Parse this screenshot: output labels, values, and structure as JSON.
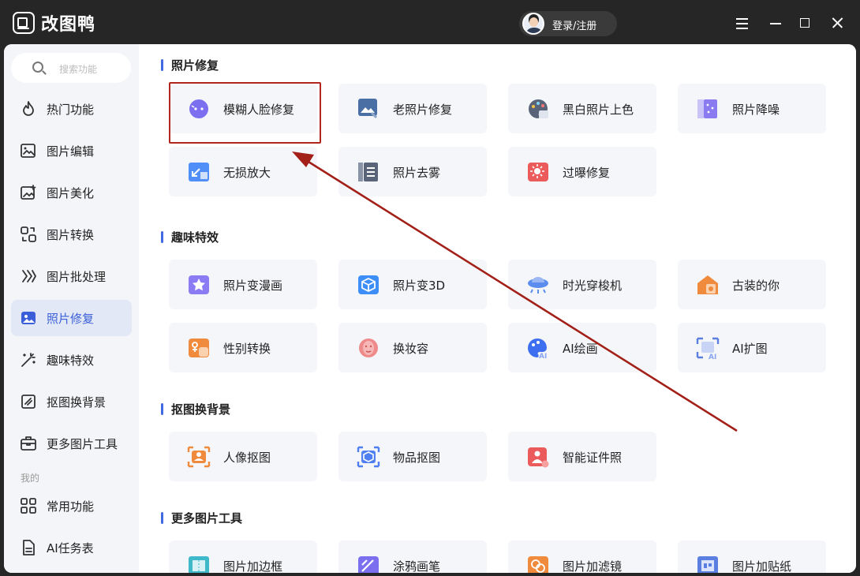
{
  "app": {
    "title": "改图鸭",
    "login_label": "登录/注册"
  },
  "sidebar": {
    "search_placeholder": "搜索功能",
    "items": [
      {
        "label": "热门功能",
        "icon": "fire-icon"
      },
      {
        "label": "图片编辑",
        "icon": "image-edit-icon"
      },
      {
        "label": "图片美化",
        "icon": "image-beautify-icon"
      },
      {
        "label": "图片转换",
        "icon": "convert-icon"
      },
      {
        "label": "图片批处理",
        "icon": "batch-icon"
      },
      {
        "label": "照片修复",
        "icon": "photo-repair-icon",
        "active": true
      },
      {
        "label": "趣味特效",
        "icon": "magic-wand-icon"
      },
      {
        "label": "抠图换背景",
        "icon": "cutout-icon"
      },
      {
        "label": "更多图片工具",
        "icon": "toolbox-icon"
      }
    ],
    "mine_label": "我的",
    "mine_items": [
      {
        "label": "常用功能",
        "icon": "grid-icon"
      },
      {
        "label": "AI任务表",
        "icon": "document-icon"
      }
    ]
  },
  "sections": [
    {
      "title": "照片修复",
      "cards": [
        {
          "label": "模糊人脸修复",
          "icon": "face-repair-icon",
          "color": "#7b6ff0"
        },
        {
          "label": "老照片修复",
          "icon": "old-photo-icon",
          "color": "#4a6fa5"
        },
        {
          "label": "黑白照片上色",
          "icon": "palette-icon",
          "color": "#5a6478"
        },
        {
          "label": "照片降噪",
          "icon": "denoise-icon",
          "color": "#8a7cf0"
        },
        {
          "label": "无损放大",
          "icon": "enlarge-icon",
          "color": "#4f8ff7"
        },
        {
          "label": "照片去雾",
          "icon": "dehaze-icon",
          "color": "#5a6478"
        },
        {
          "label": "过曝修复",
          "icon": "overexposure-icon",
          "color": "#ec5b5b"
        }
      ]
    },
    {
      "title": "趣味特效",
      "cards": [
        {
          "label": "照片变漫画",
          "icon": "comic-icon",
          "color": "#8c7cf3"
        },
        {
          "label": "照片变3D",
          "icon": "cube-icon",
          "color": "#3e8ef7"
        },
        {
          "label": "时光穿梭机",
          "icon": "time-machine-icon",
          "color": "#5b8def"
        },
        {
          "label": "古装的你",
          "icon": "ancient-costume-icon",
          "color": "#f08a3c"
        },
        {
          "label": "性别转换",
          "icon": "gender-swap-icon",
          "color": "#f08a3c"
        },
        {
          "label": "换妆容",
          "icon": "makeup-icon",
          "color": "#ef8a8a"
        },
        {
          "label": "AI绘画",
          "icon": "ai-paint-icon",
          "color": "#3e6ff0"
        },
        {
          "label": "AI扩图",
          "icon": "ai-expand-icon",
          "color": "#5b7fe0"
        }
      ]
    },
    {
      "title": "抠图换背景",
      "cards": [
        {
          "label": "人像抠图",
          "icon": "portrait-cutout-icon",
          "color": "#f08a3c"
        },
        {
          "label": "物品抠图",
          "icon": "object-cutout-icon",
          "color": "#4f7ff0"
        },
        {
          "label": "智能证件照",
          "icon": "id-photo-icon",
          "color": "#ec5b5b"
        }
      ]
    },
    {
      "title": "更多图片工具",
      "cards": [
        {
          "label": "图片加边框",
          "icon": "frame-icon",
          "color": "#3fb8c9"
        },
        {
          "label": "涂鸦画笔",
          "icon": "brush-icon",
          "color": "#7b6ff0"
        },
        {
          "label": "图片加滤镜",
          "icon": "filter-icon",
          "color": "#f08a3c"
        },
        {
          "label": "图片加贴纸",
          "icon": "sticker-icon",
          "color": "#5b7fe0"
        }
      ]
    }
  ]
}
